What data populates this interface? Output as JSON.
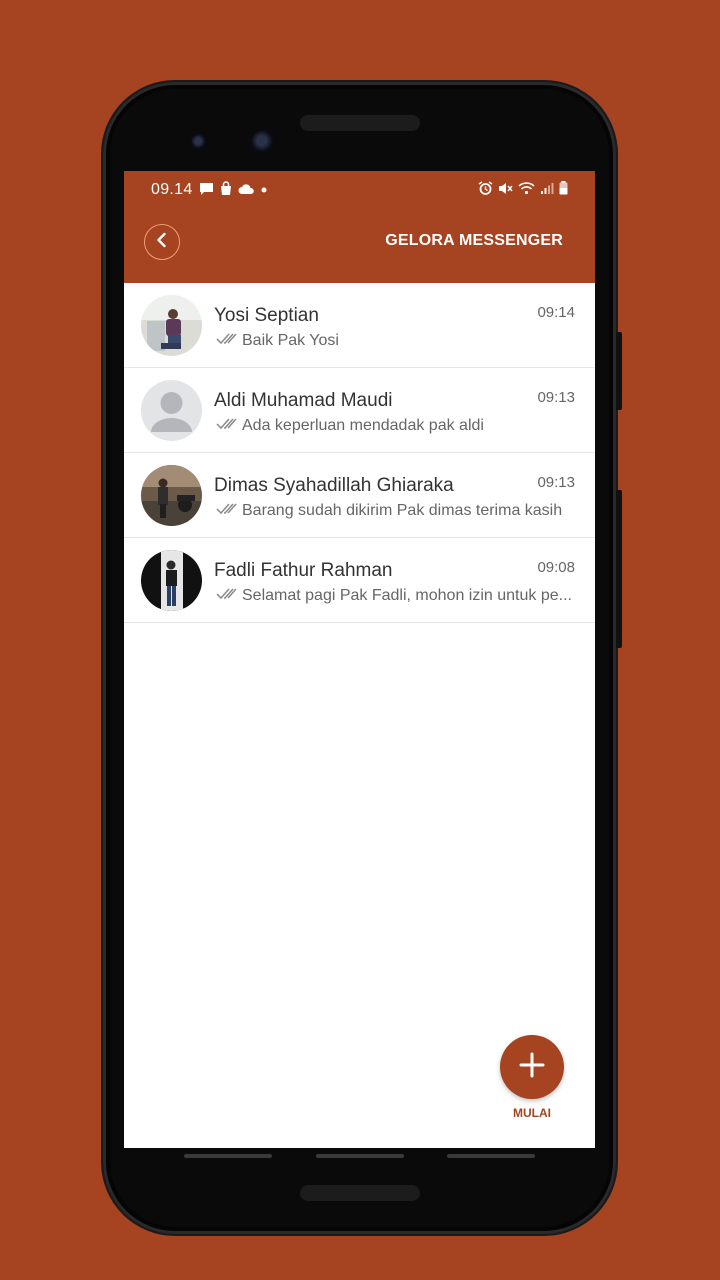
{
  "status_bar": {
    "time": "09.14",
    "icons_left": [
      "message-icon",
      "bag-icon",
      "cloud-icon",
      "dot-icon"
    ],
    "icons_right": [
      "alarm-icon",
      "mute-icon",
      "wifi-icon",
      "signal-icon",
      "battery-icon"
    ]
  },
  "header": {
    "title": "GELORA MESSENGER"
  },
  "chats": [
    {
      "name": "Yosi Septian",
      "time": "09:14",
      "preview": "Baik Pak Yosi"
    },
    {
      "name": "Aldi Muhamad Maudi",
      "time": "09:13",
      "preview": "Ada keperluan mendadak pak aldi"
    },
    {
      "name": "Dimas Syahadillah Ghiaraka",
      "time": "09:13",
      "preview": "Barang sudah dikirim Pak dimas terima kasih"
    },
    {
      "name": "Fadli Fathur Rahman",
      "time": "09:08",
      "preview": "Selamat pagi Pak Fadli, mohon izin untuk pe..."
    }
  ],
  "fab": {
    "label": "MULAI"
  },
  "colors": {
    "primary": "#a64321",
    "background": "#ffffff"
  }
}
